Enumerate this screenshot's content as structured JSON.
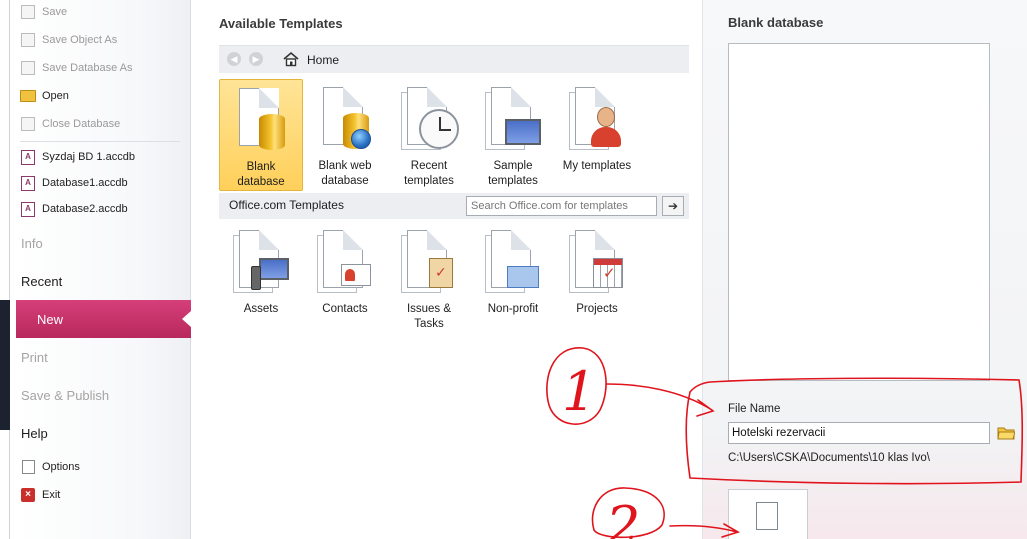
{
  "backstage": {
    "commands": [
      {
        "label": "Save",
        "icon": "save-icon",
        "disabled": true
      },
      {
        "label": "Save Object As",
        "icon": "save-object-as-icon",
        "disabled": true
      },
      {
        "label": "Save Database As",
        "icon": "save-database-as-icon",
        "disabled": true
      },
      {
        "label": "Open",
        "icon": "open-folder-icon",
        "disabled": false
      },
      {
        "label": "Close Database",
        "icon": "close-database-icon",
        "disabled": true
      }
    ],
    "recent_files": [
      "Syzdaj BD 1.accdb",
      "Database1.accdb",
      "Database2.accdb"
    ],
    "tabs": [
      {
        "label": "Info",
        "disabled": true
      },
      {
        "label": "Recent",
        "disabled": false
      },
      {
        "label": "New",
        "active": true
      },
      {
        "label": "Print",
        "disabled": true
      },
      {
        "label": "Save & Publish",
        "disabled": true
      },
      {
        "label": "Help",
        "disabled": false
      }
    ],
    "options_label": "Options",
    "exit_label": "Exit",
    "active_color": "#c8336a"
  },
  "templates": {
    "title": "Available Templates",
    "home_label": "Home",
    "items": [
      {
        "line1": "Blank",
        "line2": "database",
        "icon": "blank-database-icon",
        "selected": true
      },
      {
        "line1": "Blank web",
        "line2": "database",
        "icon": "blank-web-database-icon"
      },
      {
        "line1": "Recent",
        "line2": "templates",
        "icon": "recent-templates-icon"
      },
      {
        "line1": "Sample",
        "line2": "templates",
        "icon": "sample-templates-icon"
      },
      {
        "line1": "My templates",
        "line2": "",
        "icon": "my-templates-icon"
      }
    ],
    "office_title": "Office.com Templates",
    "search_placeholder": "Search Office.com for templates",
    "search_go": "➔",
    "office_items": [
      {
        "line1": "Assets",
        "line2": "",
        "icon": "assets-icon"
      },
      {
        "line1": "Contacts",
        "line2": "",
        "icon": "contacts-icon"
      },
      {
        "line1": "Issues &",
        "line2": "Tasks",
        "icon": "issues-tasks-icon"
      },
      {
        "line1": "Non-profit",
        "line2": "",
        "icon": "non-profit-icon"
      },
      {
        "line1": "Projects",
        "line2": "",
        "icon": "projects-icon"
      }
    ]
  },
  "blank": {
    "title": "Blank database",
    "file_name_label": "File Name",
    "file_name_value": "Hotelski rezervacii",
    "path": "C:\\Users\\CSKA\\Documents\\10 klas Ivo\\"
  },
  "annotations": {
    "label1": "1",
    "label2": "2",
    "color": "#e0141c"
  }
}
